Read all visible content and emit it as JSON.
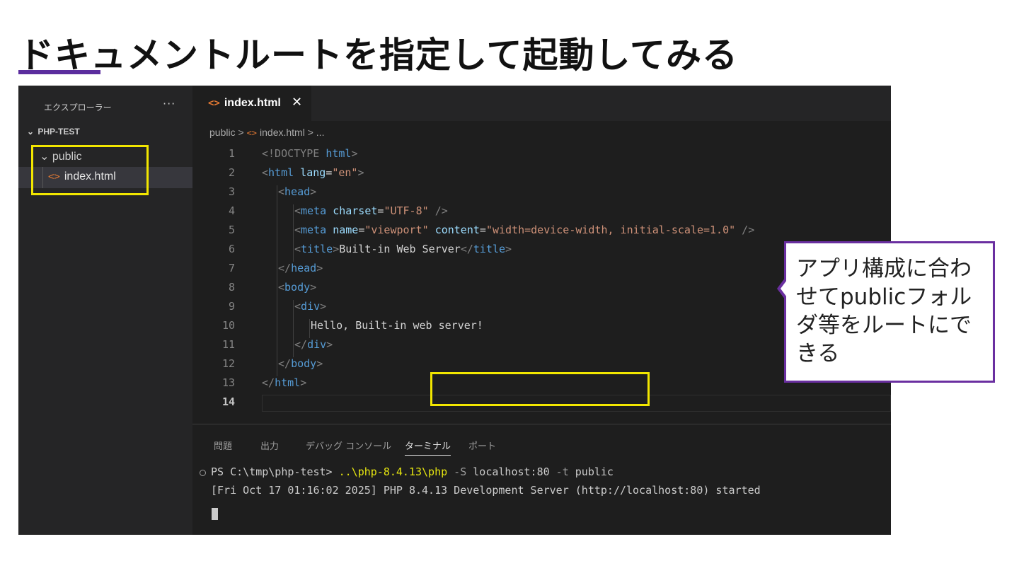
{
  "slide": {
    "title": "ドキュメントルートを指定して起動してみる"
  },
  "sidebar": {
    "header": "エクスプローラー",
    "more": "···",
    "project": "PHP-TEST",
    "folder": "public",
    "file": "index.html"
  },
  "editor": {
    "tab": {
      "label": "index.html",
      "close": "✕"
    },
    "breadcrumb": {
      "folder": "public",
      "sep": ">",
      "file": "index.html",
      "rest": "..."
    },
    "line_numbers": [
      "1",
      "2",
      "3",
      "4",
      "5",
      "6",
      "7",
      "8",
      "9",
      "10",
      "11",
      "12",
      "13",
      "14"
    ]
  },
  "panel": {
    "tabs": [
      "問題",
      "出力",
      "デバッグ コンソール",
      "ターミナル",
      "ポート"
    ],
    "active_tab": "ターミナル",
    "prompt": "PS C:\\tmp\\php-test> ",
    "command_path": "..\\php-8.4.13\\php",
    "command_flag_s": " -S ",
    "command_host": "localhost:80",
    "command_flag_t": " -t ",
    "command_docroot": "public",
    "output": "[Fri Oct 17 01:16:02 2025] PHP 8.4.13 Development Server (http://localhost:80) started"
  },
  "callout": {
    "text": "アプリ構成に合わせてpublicフォルダ等をルートにできる"
  },
  "colors": {
    "accent": "#5b2d9e",
    "highlight": "#f2e600",
    "callout_border": "#6a2fa0"
  }
}
